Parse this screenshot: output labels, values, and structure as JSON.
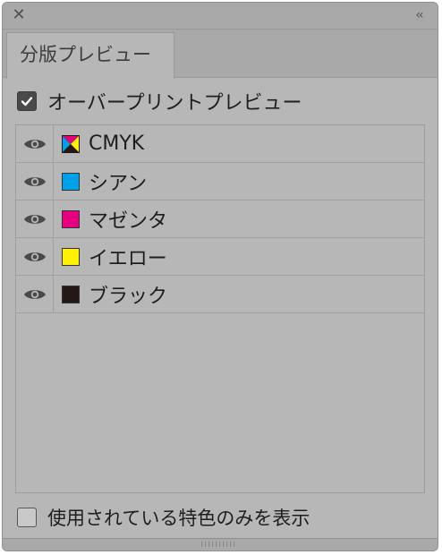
{
  "panel": {
    "close_glyph": "✕",
    "collapse_glyph": "‹‹",
    "tab_label": "分版プレビュー",
    "overprint_label": "オーバープリントプレビュー",
    "overprint_checked": true,
    "plates": [
      {
        "label": "CMYK",
        "color": "cmyk",
        "visible": true
      },
      {
        "label": "シアン",
        "color": "#00a0e9",
        "visible": true
      },
      {
        "label": "マゼンタ",
        "color": "#e4007f",
        "visible": true
      },
      {
        "label": "イエロー",
        "color": "#fff100",
        "visible": true
      },
      {
        "label": "ブラック",
        "color": "#231815",
        "visible": true
      }
    ],
    "spot_only_label": "使用されている特色のみを表示",
    "spot_only_checked": false
  }
}
